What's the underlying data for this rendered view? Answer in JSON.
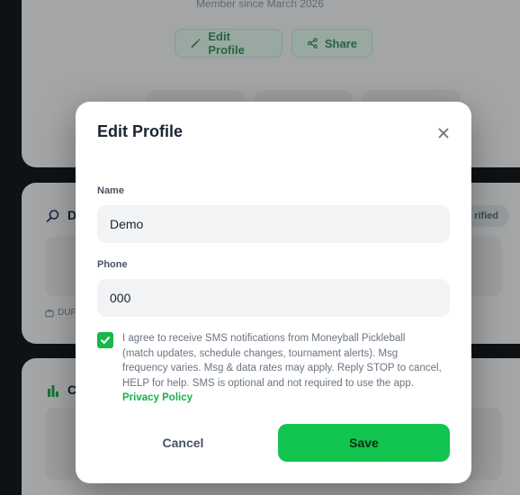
{
  "background": {
    "profile_card": {
      "member_since": "Member since March 2026",
      "edit_profile_label": "Edit Profile",
      "share_label": "Share"
    },
    "dupr_card": {
      "title_initial": "D",
      "verified_badge": "rified",
      "note": "DUF"
    },
    "stats_card": {
      "title_initial": "C"
    }
  },
  "modal": {
    "title": "Edit Profile",
    "close_icon": "close-icon",
    "fields": {
      "name": {
        "label": "Name",
        "value": "Demo"
      },
      "phone": {
        "label": "Phone",
        "value": "000"
      }
    },
    "sms_consent": {
      "checked": true,
      "lines": [
        "I agree to receive SMS notifications from Moneyball Pickleball",
        "(match updates, schedule changes, tournament alerts). Msg",
        "frequency varies. Msg & data rates may apply. Reply STOP to cancel,",
        "HELP for help. SMS is optional and not required to use the app."
      ],
      "privacy_link": "Privacy Policy"
    },
    "actions": {
      "cancel_label": "Cancel",
      "save_label": "Save"
    }
  },
  "colors": {
    "accent_green": "#12c450",
    "checkbox_green": "#18b84a",
    "link_green": "#17b04a",
    "page_background": "#0f1419",
    "card_background": "#ececec"
  }
}
